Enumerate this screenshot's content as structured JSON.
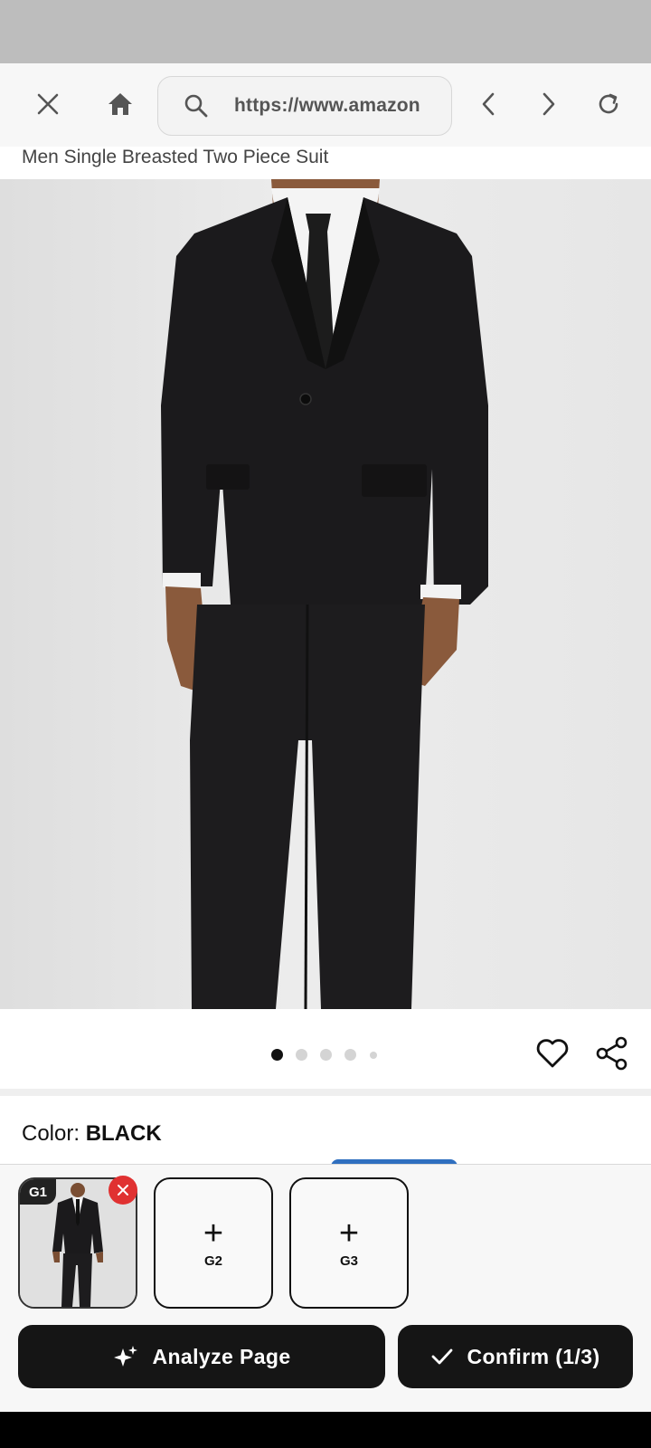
{
  "browser": {
    "url": "https://www.amazon",
    "close_icon": "close-icon",
    "home_icon": "home-icon",
    "search_icon": "search-icon",
    "back_icon": "chevron-left-icon",
    "forward_icon": "chevron-right-icon",
    "reload_icon": "reload-icon"
  },
  "product": {
    "title": "Men Single Breasted Two Piece Suit",
    "image_slides": 5,
    "active_slide": 1,
    "color_label": "Color: ",
    "color_value": "BLACK"
  },
  "slots": [
    {
      "label": "G1",
      "filled": true
    },
    {
      "label": "G2",
      "filled": false,
      "plus": "+"
    },
    {
      "label": "G3",
      "filled": false,
      "plus": "+"
    }
  ],
  "actions": {
    "analyze_label": "Analyze Page",
    "confirm_label": "Confirm (1/3)"
  },
  "colors": {
    "accent_dark": "#151515",
    "remove_red": "#e03131",
    "status_gray": "#bdbdbd"
  }
}
